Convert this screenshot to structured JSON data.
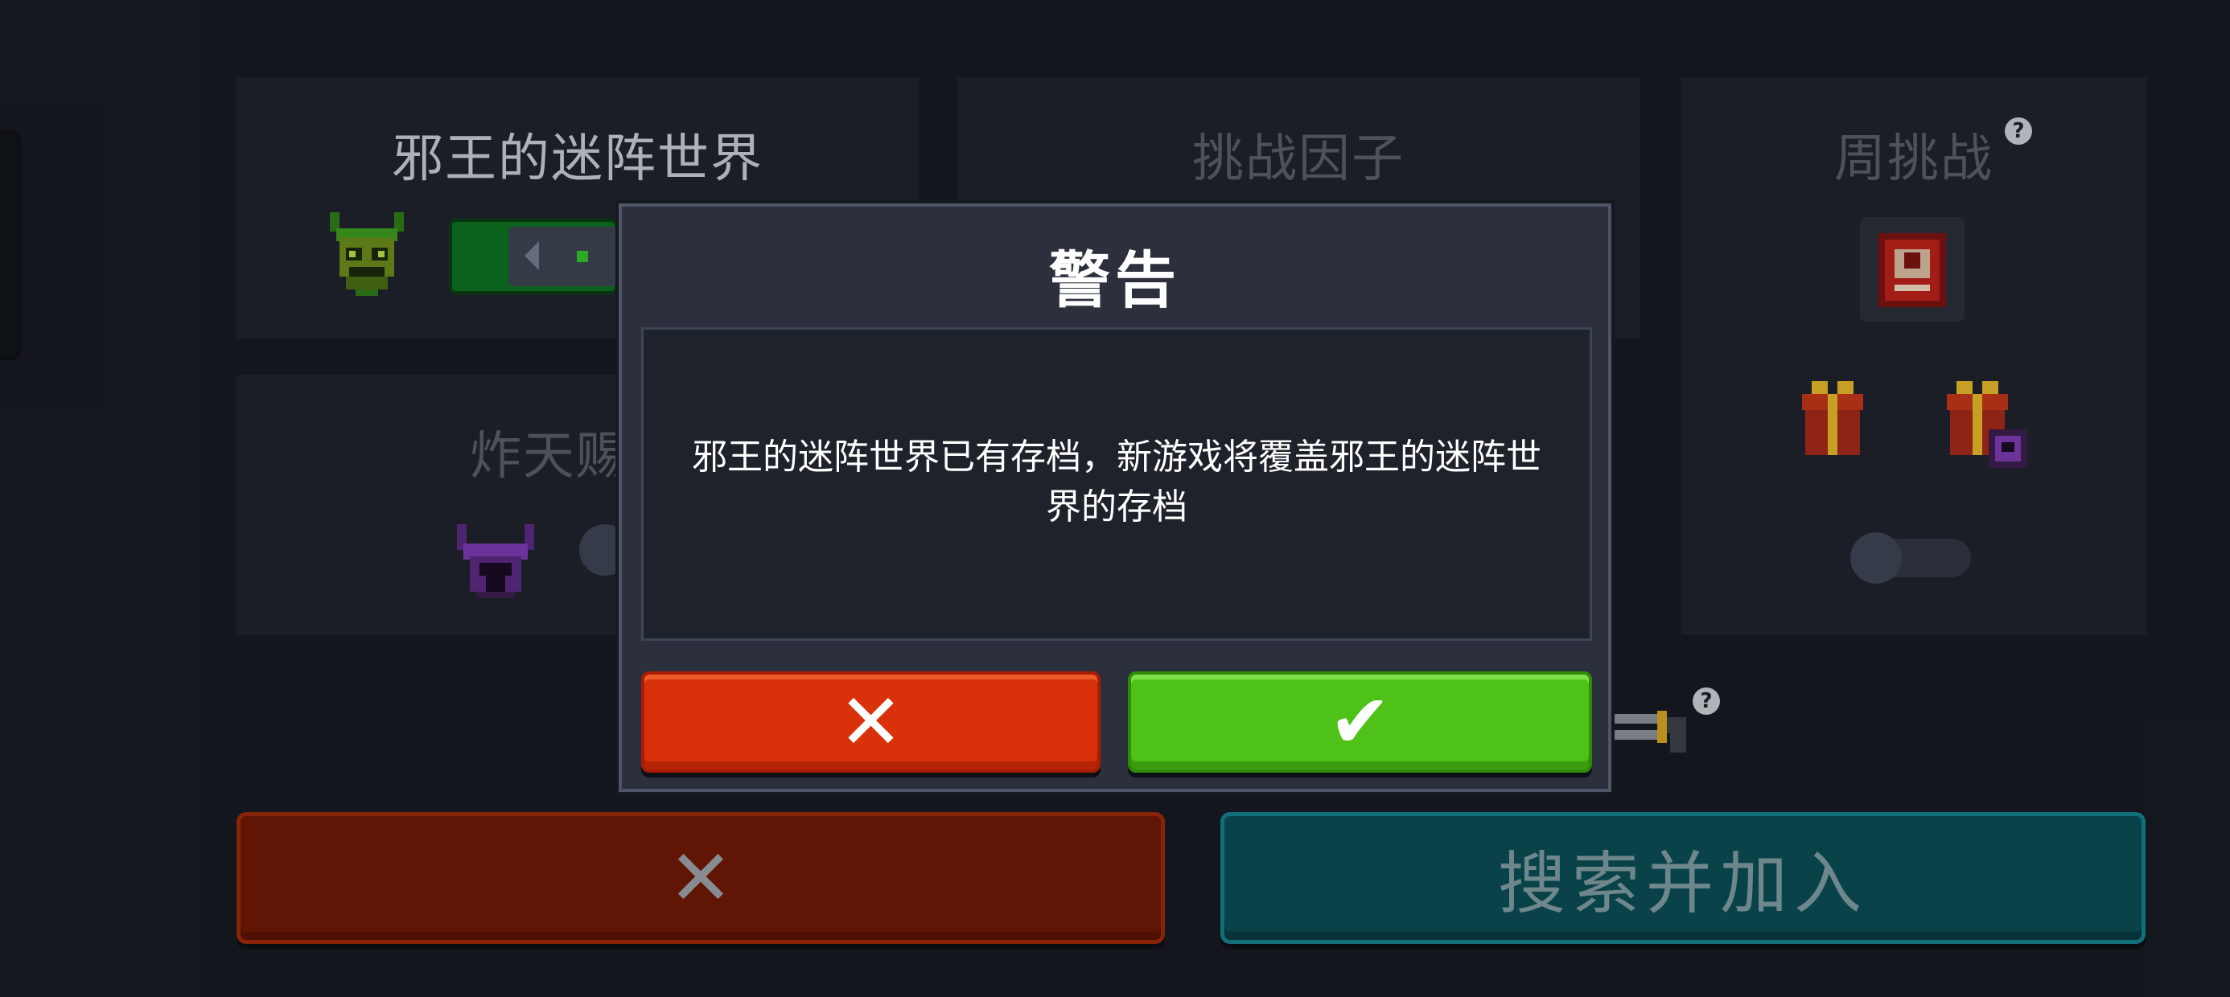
{
  "panels": {
    "mode": {
      "title": "邪王的迷阵世界"
    },
    "challenge": {
      "title": "挑战因子"
    },
    "weekly": {
      "title": "周挑战",
      "help": "?"
    },
    "bomb": {
      "title": "炸天赐"
    }
  },
  "dialog": {
    "title": "警告",
    "message": "邪王的迷阵世界已有存档，新游戏将覆盖邪王的迷阵世界的存档",
    "cancel_symbol": "✕",
    "confirm_symbol": "✔"
  },
  "bottom": {
    "cancel_symbol": "✕",
    "join_label": "搜索并加入"
  },
  "misc": {
    "help": "?"
  },
  "colors": {
    "background": "#161a22",
    "panel": "#1f232c",
    "dialog": "#2b303c",
    "cancel_red": "#d93109",
    "confirm_green": "#4fc219",
    "dim_red": "#6f1905",
    "teal": "#0c4c55"
  },
  "toggles": {
    "bomb_toggle": "off",
    "weekly_toggle": "off"
  }
}
